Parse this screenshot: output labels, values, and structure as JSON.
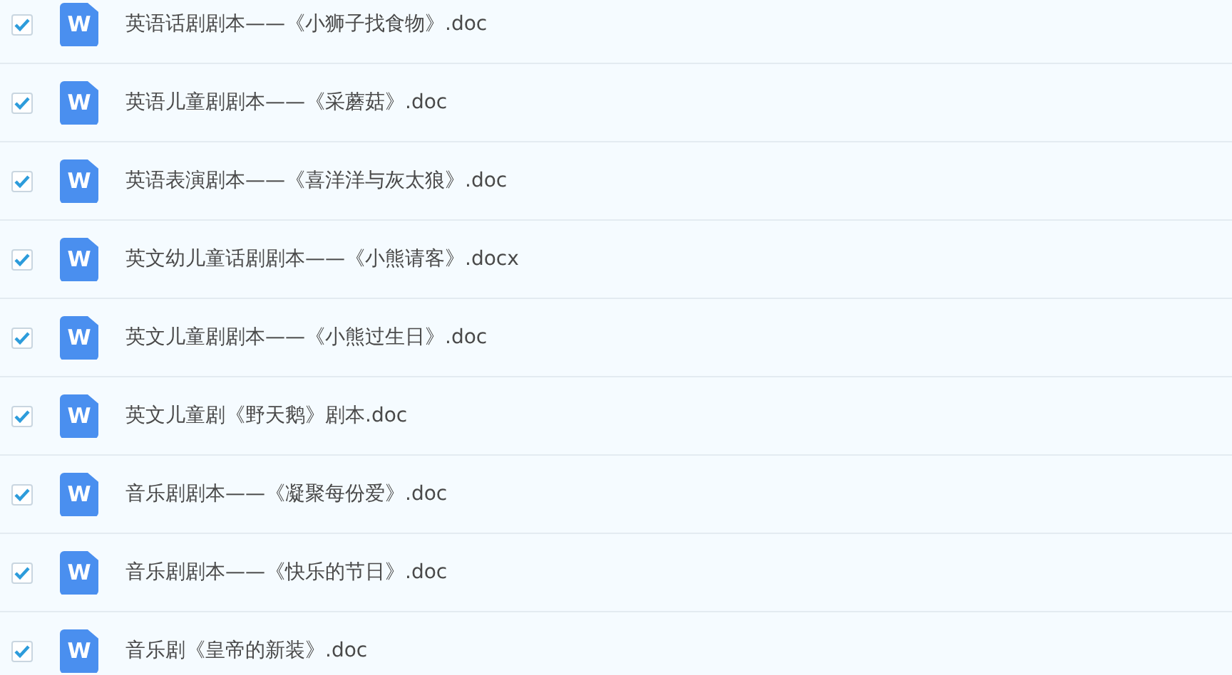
{
  "files": [
    {
      "name": "英语话剧剧本——《小狮子找食物》.doc",
      "icon_letter": "W",
      "checked": true
    },
    {
      "name": "英语儿童剧剧本——《采蘑菇》.doc",
      "icon_letter": "W",
      "checked": true
    },
    {
      "name": "英语表演剧本——《喜洋洋与灰太狼》.doc",
      "icon_letter": "W",
      "checked": true
    },
    {
      "name": "英文幼儿童话剧剧本——《小熊请客》.docx",
      "icon_letter": "W",
      "checked": true
    },
    {
      "name": "英文儿童剧剧本——《小熊过生日》.doc",
      "icon_letter": "W",
      "checked": true
    },
    {
      "name": "英文儿童剧《野天鹅》剧本.doc",
      "icon_letter": "W",
      "checked": true
    },
    {
      "name": "音乐剧剧本——《凝聚每份爱》.doc",
      "icon_letter": "W",
      "checked": true
    },
    {
      "name": "音乐剧剧本——《快乐的节日》.doc",
      "icon_letter": "W",
      "checked": true
    },
    {
      "name": "音乐剧《皇帝的新装》.doc",
      "icon_letter": "W",
      "checked": true
    }
  ]
}
